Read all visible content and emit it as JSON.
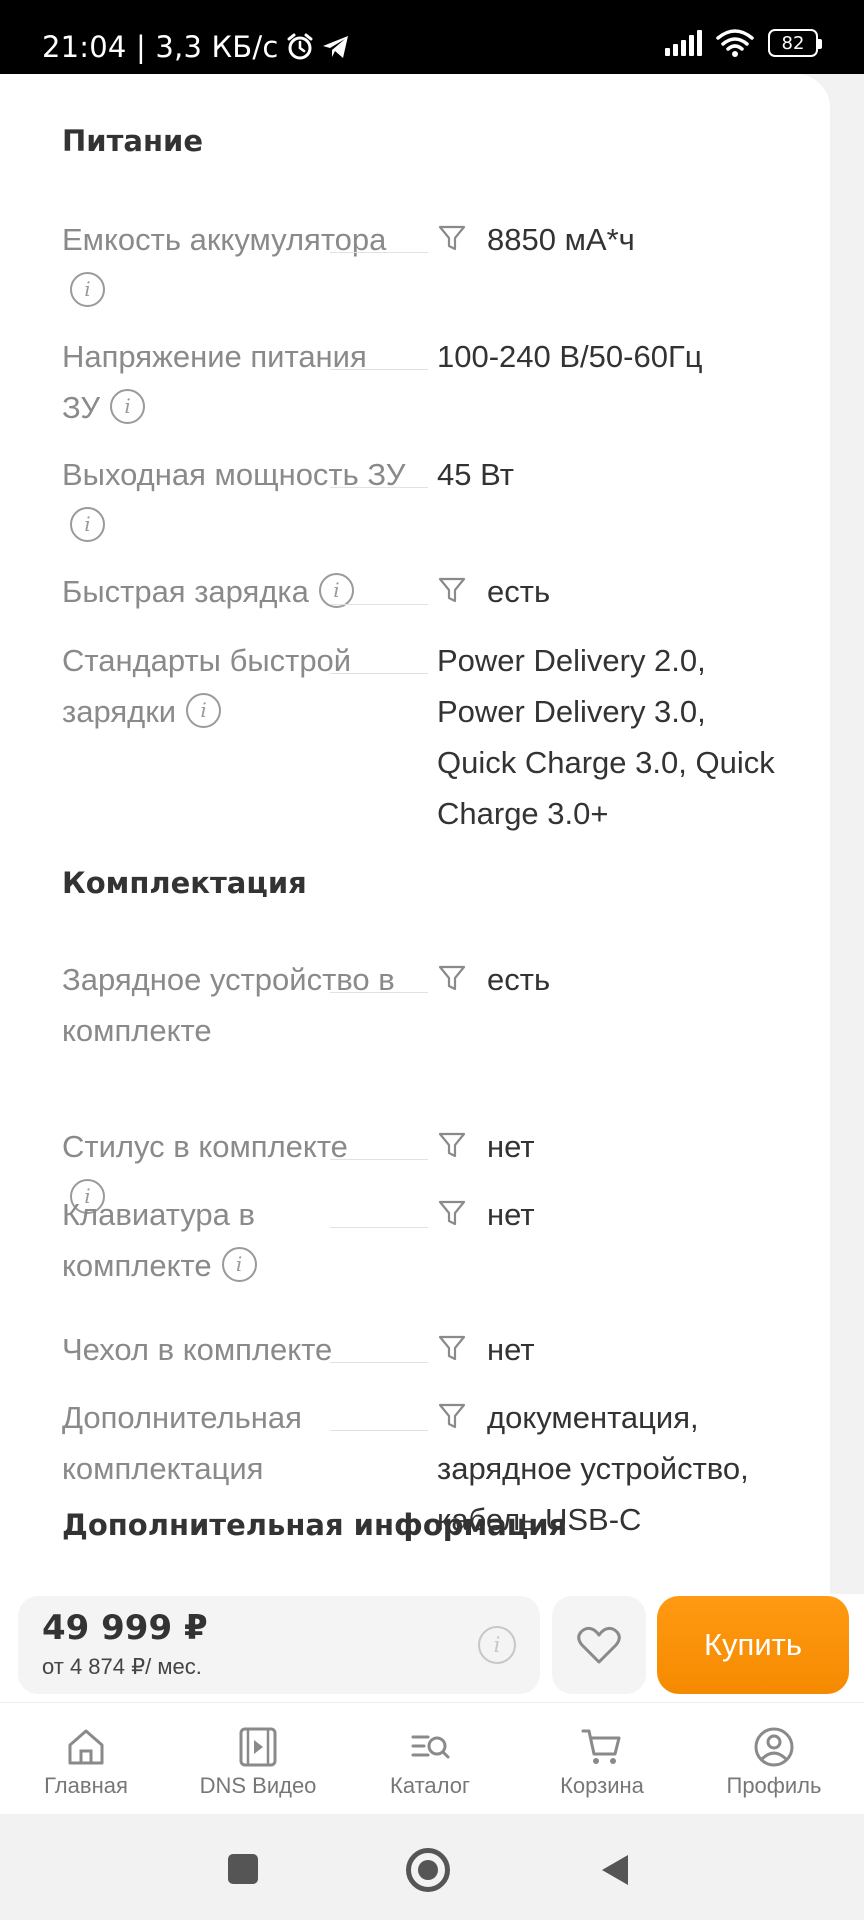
{
  "status_bar": {
    "time_speed": "21:04 | 3,3 КБ/с",
    "battery": "82"
  },
  "sections": [
    {
      "title": "Питание",
      "rows": [
        {
          "label_lines": [
            "Емкость аккумулятора"
          ],
          "has_info": true,
          "has_filter": true,
          "value_lines": [
            "8850 мА*ч"
          ]
        },
        {
          "label_lines": [
            "Напряжение питания",
            "ЗУ"
          ],
          "has_info": true,
          "has_filter": false,
          "value_lines": [
            "100-240 В/50-60Гц"
          ]
        },
        {
          "label_lines": [
            "Выходная мощность ЗУ"
          ],
          "has_info": true,
          "has_filter": false,
          "value_lines": [
            "45 Вт"
          ]
        },
        {
          "label_lines": [
            "Быстрая зарядка"
          ],
          "has_info": true,
          "has_filter": true,
          "value_lines": [
            "есть"
          ]
        },
        {
          "label_lines": [
            "Стандарты быстрой",
            "зарядки"
          ],
          "has_info": true,
          "has_filter": false,
          "value_lines": [
            "Power Delivery 2.0,",
            "Power Delivery 3.0,",
            "Quick Charge 3.0, Quick",
            "Charge 3.0+"
          ]
        }
      ]
    },
    {
      "title": "Комплектация",
      "rows": [
        {
          "label_lines": [
            "Зарядное устройство в",
            "комплекте"
          ],
          "has_info": false,
          "has_filter": true,
          "value_lines": [
            "есть"
          ]
        },
        {
          "label_lines": [
            "Стилус в комплекте"
          ],
          "has_info": true,
          "has_filter": true,
          "value_lines": [
            "нет"
          ]
        },
        {
          "label_lines": [
            "Клавиатура в",
            "комплекте"
          ],
          "has_info": true,
          "has_filter": true,
          "value_lines": [
            "нет"
          ]
        },
        {
          "label_lines": [
            "Чехол в комплекте"
          ],
          "has_info": false,
          "has_filter": true,
          "value_lines": [
            "нет"
          ]
        },
        {
          "label_lines": [
            "Дополнительная",
            "комплектация"
          ],
          "has_info": false,
          "has_filter": true,
          "value_lines": [
            "документация,",
            "зарядное устройство,",
            "кабель USB-C"
          ]
        }
      ]
    },
    {
      "title": "Дополнительная информация",
      "rows": []
    }
  ],
  "purchase": {
    "price": "49 999 ₽",
    "credit": "от 4 874 ₽/ мес.",
    "buy_label": "Купить"
  },
  "bottom_nav": [
    {
      "label": "Главная",
      "icon": "home-icon"
    },
    {
      "label": "DNS Видео",
      "icon": "video-icon"
    },
    {
      "label": "Каталог",
      "icon": "catalog-icon"
    },
    {
      "label": "Корзина",
      "icon": "cart-icon"
    },
    {
      "label": "Профиль",
      "icon": "profile-icon"
    }
  ]
}
